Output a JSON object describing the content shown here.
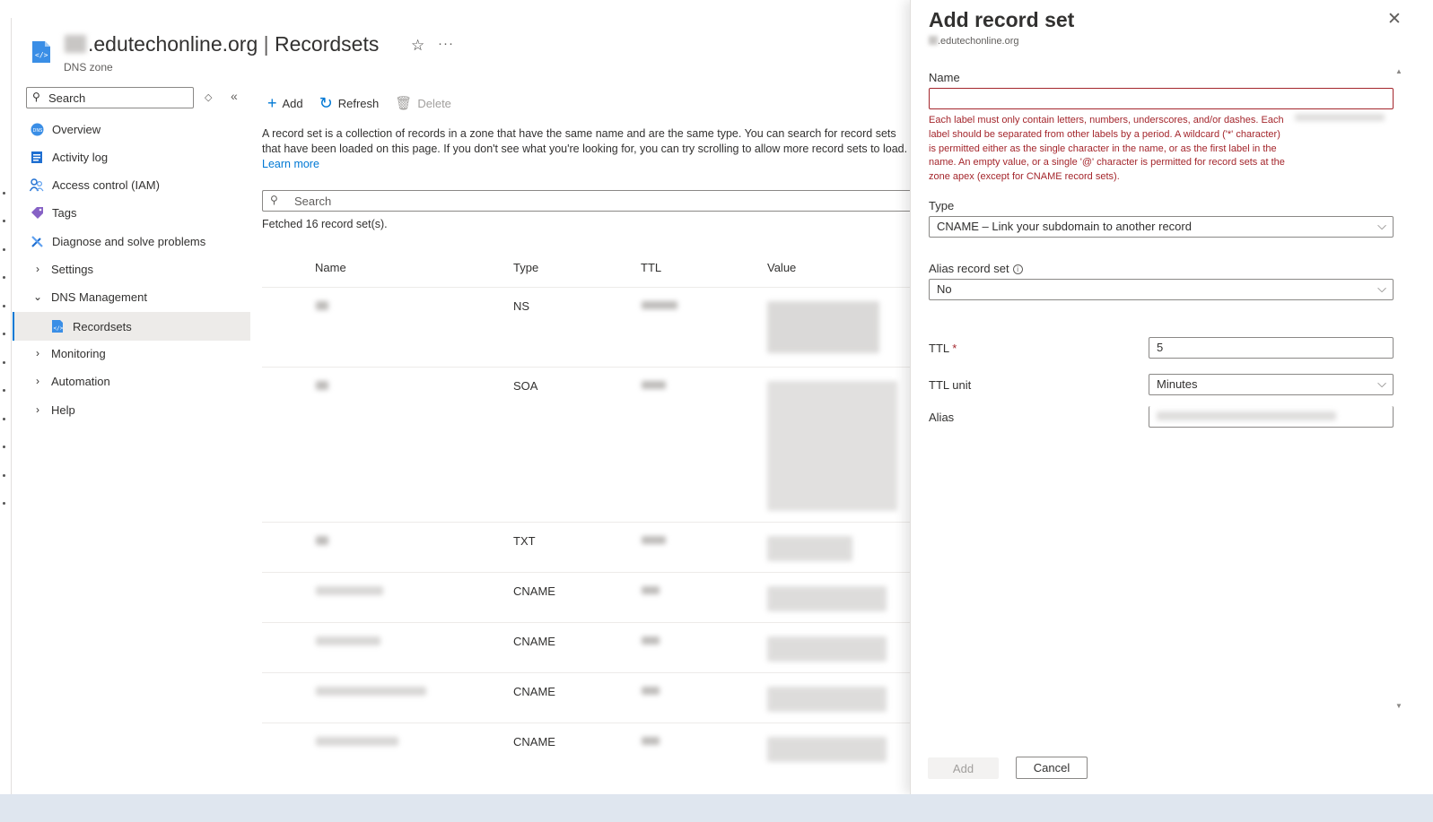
{
  "header": {
    "title_domain": ".edutechonline.org",
    "title_sep": "|",
    "title_page": "Recordsets",
    "subtitle": "DNS zone",
    "favorite_icon": "star-icon",
    "more_label": "···"
  },
  "sidebar": {
    "search_placeholder": "Search",
    "collapse_label": "«",
    "items": [
      {
        "label": "Overview",
        "icon": "dns-globe-icon"
      },
      {
        "label": "Activity log",
        "icon": "activity-log-icon"
      },
      {
        "label": "Access control (IAM)",
        "icon": "people-icon"
      },
      {
        "label": "Tags",
        "icon": "tag-icon"
      },
      {
        "label": "Diagnose and solve problems",
        "icon": "wrench-icon"
      },
      {
        "label": "Settings",
        "icon": "chevron-right-icon"
      },
      {
        "label": "DNS Management",
        "icon": "chevron-down-icon"
      },
      {
        "label": "Recordsets",
        "icon": "recordsets-icon"
      },
      {
        "label": "Monitoring",
        "icon": "chevron-right-icon"
      },
      {
        "label": "Automation",
        "icon": "chevron-right-icon"
      },
      {
        "label": "Help",
        "icon": "chevron-right-icon"
      }
    ]
  },
  "toolbar": {
    "add_label": "Add",
    "refresh_label": "Refresh",
    "delete_label": "Delete"
  },
  "main": {
    "description": "A record set is a collection of records in a zone that have the same name and are the same type. You can search for record sets that have been loaded on this page. If you don't see what you're looking for, you can try scrolling to allow more record sets to load.",
    "learn_more": "Learn more",
    "search_placeholder": "Search",
    "fetched_text": "Fetched 16 record set(s).",
    "columns": [
      "Name",
      "Type",
      "TTL",
      "Value"
    ],
    "rows": [
      {
        "type": "NS"
      },
      {
        "type": "SOA"
      },
      {
        "type": "TXT"
      },
      {
        "type": "CNAME"
      },
      {
        "type": "CNAME"
      },
      {
        "type": "CNAME"
      },
      {
        "type": "CNAME"
      }
    ]
  },
  "panel": {
    "title": "Add record set",
    "subtitle": ".edutechonline.org",
    "name_label": "Name",
    "name_value": "",
    "name_error": "Each label must only contain letters, numbers, underscores, and/or dashes. Each label should be separated from other labels by a period. A wildcard ('*' character) is permitted either as the single character in the name, or as the first label in the name. An empty value, or a single '@' character is permitted for record sets at the zone apex (except for CNAME record sets).",
    "type_label": "Type",
    "type_value": "CNAME – Link your subdomain to another record",
    "alias_record_label": "Alias record set",
    "alias_record_value": "No",
    "ttl_label": "TTL",
    "ttl_required": "*",
    "ttl_value": "5",
    "ttl_unit_label": "TTL unit",
    "ttl_unit_value": "Minutes",
    "alias_label": "Alias",
    "add_button": "Add",
    "cancel_button": "Cancel"
  },
  "colors": {
    "accent": "#0078d4",
    "error": "#a4262c",
    "nav_active_bg": "#edebe9"
  }
}
